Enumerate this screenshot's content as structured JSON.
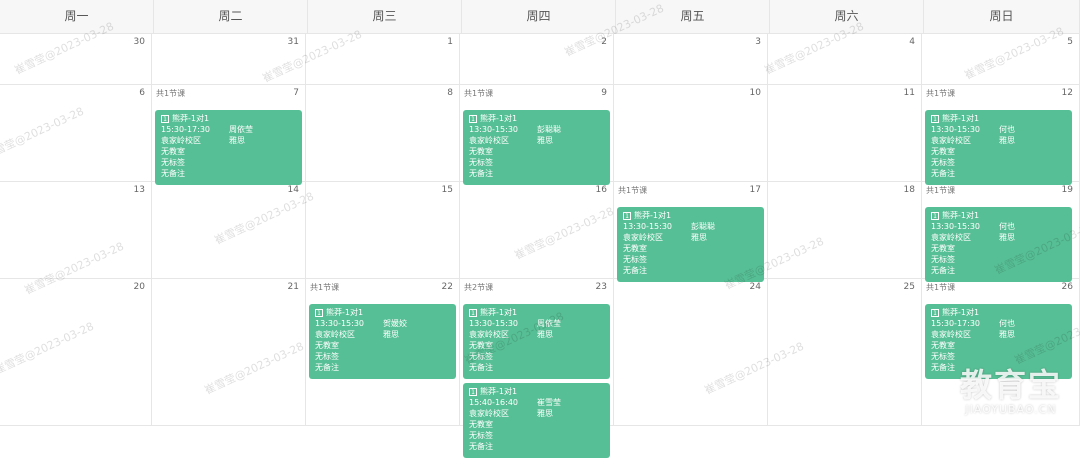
{
  "weekdays": [
    "周一",
    "周二",
    "周三",
    "周四",
    "周五",
    "周六",
    "周日"
  ],
  "rows": [
    {
      "days": [
        {
          "num": "30"
        },
        {
          "num": "31"
        },
        {
          "num": "1"
        },
        {
          "num": "2"
        },
        {
          "num": "3"
        },
        {
          "num": "4"
        },
        {
          "num": "5"
        }
      ]
    },
    {
      "days": [
        {
          "num": "6"
        },
        {
          "num": "7",
          "count": "共1节课",
          "cards": [
            {
              "name": "熊莽-1对1",
              "time": "15:30-17:30",
              "teacher": "周依莹",
              "campus": "袁家岭校区",
              "brand": "雅思",
              "room": "无教室",
              "tag": "无标签",
              "note": "无备注"
            }
          ]
        },
        {
          "num": "8"
        },
        {
          "num": "9",
          "count": "共1节课",
          "cards": [
            {
              "name": "熊莽-1对1",
              "time": "13:30-15:30",
              "teacher": "彭聪聪",
              "campus": "袁家岭校区",
              "brand": "雅思",
              "room": "无教室",
              "tag": "无标签",
              "note": "无备注"
            }
          ]
        },
        {
          "num": "10"
        },
        {
          "num": "11"
        },
        {
          "num": "12",
          "count": "共1节课",
          "cards": [
            {
              "name": "熊莽-1对1",
              "time": "13:30-15:30",
              "teacher": "何也",
              "campus": "袁家岭校区",
              "brand": "雅思",
              "room": "无教室",
              "tag": "无标签",
              "note": "无备注"
            }
          ]
        }
      ]
    },
    {
      "days": [
        {
          "num": "13"
        },
        {
          "num": "14"
        },
        {
          "num": "15"
        },
        {
          "num": "16"
        },
        {
          "num": "17",
          "count": "共1节课",
          "cards": [
            {
              "name": "熊莽-1对1",
              "time": "13:30-15:30",
              "teacher": "彭聪聪",
              "campus": "袁家岭校区",
              "brand": "雅思",
              "room": "无教室",
              "tag": "无标签",
              "note": "无备注"
            }
          ]
        },
        {
          "num": "18"
        },
        {
          "num": "19",
          "count": "共1节课",
          "cards": [
            {
              "name": "熊莽-1对1",
              "time": "13:30-15:30",
              "teacher": "何也",
              "campus": "袁家岭校区",
              "brand": "雅思",
              "room": "无教室",
              "tag": "无标签",
              "note": "无备注"
            }
          ]
        }
      ]
    },
    {
      "days": [
        {
          "num": "20"
        },
        {
          "num": "21"
        },
        {
          "num": "22",
          "count": "共1节课",
          "cards": [
            {
              "name": "熊莽-1对1",
              "time": "13:30-15:30",
              "teacher": "贺媛姣",
              "campus": "袁家岭校区",
              "brand": "雅思",
              "room": "无教室",
              "tag": "无标签",
              "note": "无备注"
            }
          ]
        },
        {
          "num": "23",
          "count": "共2节课",
          "cards": [
            {
              "name": "熊莽-1对1",
              "time": "13:30-15:30",
              "teacher": "周依莹",
              "campus": "袁家岭校区",
              "brand": "雅思",
              "room": "无教室",
              "tag": "无标签",
              "note": "无备注"
            },
            {
              "name": "熊莽-1对1",
              "time": "15:40-16:40",
              "teacher": "崔雪莹",
              "campus": "袁家岭校区",
              "brand": "雅思",
              "room": "无教室",
              "tag": "无标签",
              "note": "无备注"
            }
          ]
        },
        {
          "num": "24"
        },
        {
          "num": "25"
        },
        {
          "num": "26",
          "count": "共1节课",
          "cards": [
            {
              "name": "熊莽-1对1",
              "time": "15:30-17:30",
              "teacher": "何也",
              "campus": "袁家岭校区",
              "brand": "雅思",
              "room": "无教室",
              "tag": "无标签",
              "note": "无备注"
            }
          ]
        }
      ]
    }
  ],
  "watermark": "崔雪莹@2023-03-28",
  "logo": {
    "cn": "教育宝",
    "en": "JIAOYUBAO.CN"
  },
  "colors": {
    "card": "#57bf95",
    "grid": "#e6e6e6",
    "header_bg": "#f7f7f7"
  }
}
